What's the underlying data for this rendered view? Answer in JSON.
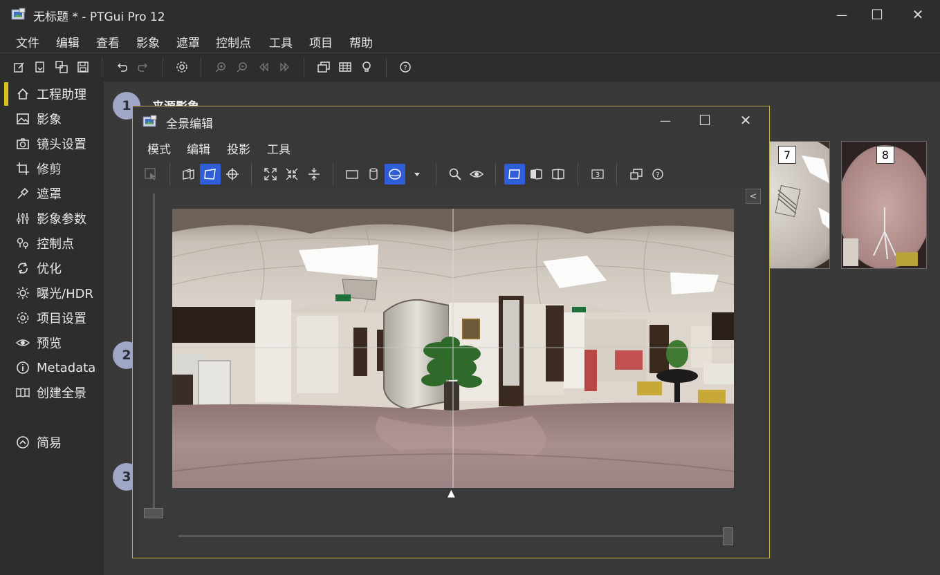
{
  "window": {
    "title": "无标题 * - PTGui Pro 12",
    "minimize_glyph": "—",
    "maximize_glyph": "☐",
    "close_glyph": "✕"
  },
  "menubar": [
    "文件",
    "编辑",
    "查看",
    "影象",
    "遮罩",
    "控制点",
    "工具",
    "项目",
    "帮助"
  ],
  "toolbar_icons": [
    "new-project-icon",
    "open-project-icon",
    "open-template-icon",
    "save-icon",
    "undo-icon",
    "redo-icon",
    "settings-icon",
    "zoom-in-icon",
    "zoom-out-icon",
    "previous-icon",
    "next-icon",
    "panorama-editor-icon",
    "table-icon",
    "lightbulb-icon",
    "help-icon"
  ],
  "sidebar": {
    "items": [
      {
        "label": "工程助理",
        "icon": "home-icon",
        "active": true
      },
      {
        "label": "影象",
        "icon": "image-icon"
      },
      {
        "label": "镜头设置",
        "icon": "camera-icon"
      },
      {
        "label": "修剪",
        "icon": "crop-icon"
      },
      {
        "label": "遮罩",
        "icon": "mask-icon"
      },
      {
        "label": "影象参数",
        "icon": "sliders-icon"
      },
      {
        "label": "控制点",
        "icon": "control-points-icon"
      },
      {
        "label": "优化",
        "icon": "optimize-icon"
      },
      {
        "label": "曝光/HDR",
        "icon": "sun-icon"
      },
      {
        "label": "项目设置",
        "icon": "gear-icon"
      },
      {
        "label": "预览",
        "icon": "eye-icon"
      },
      {
        "label": "Metadata",
        "icon": "info-icon"
      },
      {
        "label": "创建全景",
        "icon": "panorama-icon"
      }
    ],
    "simple_label": "简易"
  },
  "main": {
    "steps": [
      "1",
      "2",
      "3"
    ],
    "section_title": "来源影象",
    "thumbnails": [
      {
        "num": "7"
      },
      {
        "num": "8"
      }
    ]
  },
  "dialog": {
    "title": "全景编辑",
    "menu": [
      "模式",
      "编辑",
      "投影",
      "工具"
    ],
    "toolbar_icons": [
      "select-icon",
      "move-panorama-icon",
      "free-transform-icon",
      "crosshair-icon",
      "fit-icon",
      "center-icon",
      "straighten-icon",
      "rectangular-projection-icon",
      "cylindrical-projection-icon",
      "spherical-projection-icon",
      "dropdown-icon",
      "zoom-icon",
      "preview-eye-icon",
      "rectilinear-view-icon",
      "half-view-icon",
      "book-view-icon",
      "number-icon",
      "panorama-window-icon",
      "help-icon"
    ],
    "collapse_glyph": "<",
    "center_marker": "▲"
  },
  "colors": {
    "accent": "#2f5ed8",
    "active_bar": "#d8c21c",
    "step_circle": "#9fa6c6",
    "dialog_border": "#bfb24a"
  }
}
